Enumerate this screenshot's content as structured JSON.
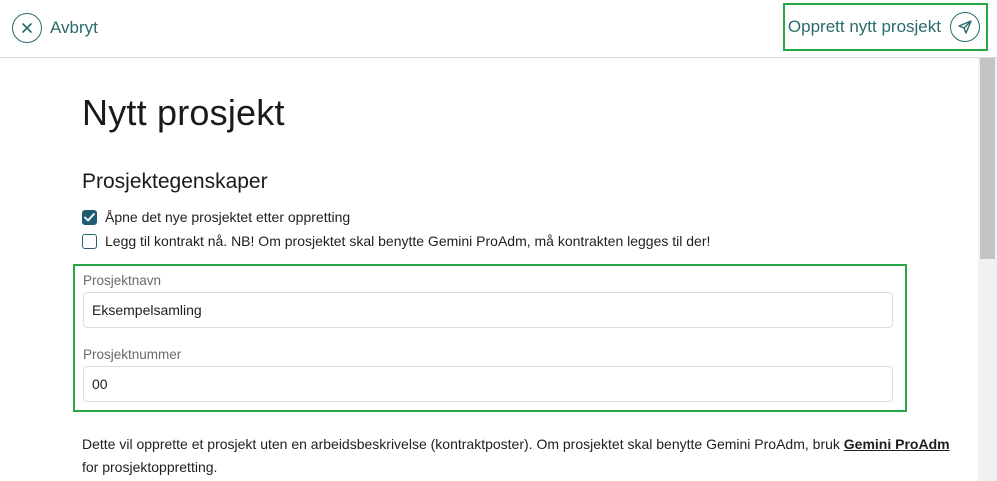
{
  "topbar": {
    "cancel_label": "Avbryt",
    "cancel_icon": "close-icon",
    "create_label": "Opprett nytt prosjekt",
    "create_icon": "send-icon",
    "accent_color": "#2a6b6b",
    "highlight_color": "#27a745"
  },
  "page": {
    "title": "Nytt prosjekt",
    "section_title": "Prosjektegenskaper"
  },
  "options": [
    {
      "label": "Åpne det nye prosjektet etter oppretting",
      "checked": true
    },
    {
      "label": "Legg til kontrakt nå. NB! Om prosjektet skal benytte Gemini ProAdm, må kontrakten legges til der!",
      "checked": false
    }
  ],
  "fields": {
    "name_label": "Prosjektnavn",
    "name_value": "Eksempelsamling",
    "number_label": "Prosjektnummer",
    "number_value": "00"
  },
  "info": {
    "text_before": "Dette vil opprette et prosjekt uten en arbeidsbeskrivelse (kontraktposter). Om prosjektet skal benytte Gemini ProAdm, bruk ",
    "link_text": "Gemini ProAdm",
    "text_after": " for prosjektoppretting."
  }
}
